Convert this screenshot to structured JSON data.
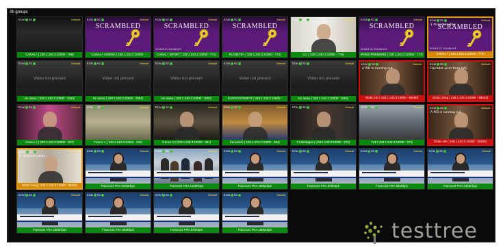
{
  "panel": {
    "title": "All groups"
  },
  "indicator": {
    "ecm": "ECM",
    "sc": "SC",
    "default": "Default"
  },
  "tiles": [
    {
      "label": "CANAL+ ( 228.1.240.2:10000 - 769)",
      "status": "green",
      "video": "dark-text",
      "frame": "none"
    },
    {
      "label": "CANAL+ CINEMA ( 228.1.240.2:10000 -",
      "status": "green",
      "video": "scrambled",
      "frame": "none"
    },
    {
      "label": "CANAL+ SPORT ( 228.1.240.2:10000 - 771)",
      "status": "green",
      "video": "scrambled",
      "frame": "none",
      "foot": "2018-8-21 20h18m21"
    },
    {
      "label": "PLANETE+ ( 228.1.240.2:10000 - 772)",
      "status": "green",
      "video": "scrambled",
      "frame": "none"
    },
    {
      "label": "LCI ( 228.1.240.2:10000 - 776)",
      "status": "green",
      "video": "face-white",
      "frame": "none"
    },
    {
      "label": "PARIS PREMIERE ( 228.1.240.2:10000 - 777)",
      "status": "green",
      "video": "scrambled",
      "frame": "none",
      "foot": "2018-8-21 20h18m23"
    },
    {
      "label": "CANAL+ ( 228.1.240.2:10000 - 778)",
      "status": "orange",
      "video": "scrambled",
      "frame": "orange",
      "error": "1 discontinuities",
      "foot": "2018-8-21 20h18m23"
    },
    {
      "label": "No name ( 228.1.240.2:10000 - 1050)",
      "status": "green",
      "video": "notpresent",
      "frame": "none"
    },
    {
      "label": "No name ( 228.1.240.2:10000 - 1051)",
      "status": "green",
      "video": "notpresent",
      "frame": "none"
    },
    {
      "label": "No name ( 228.1.240.2:10000 - 1052)",
      "status": "green",
      "video": "notpresent",
      "frame": "none"
    },
    {
      "label": "DATASYSTEM R7 ( 228.1.240.2:10000 -",
      "status": "green",
      "video": "notpresent",
      "frame": "none"
    },
    {
      "label": "No name ( 228.1.240.2:10000 - 1054)",
      "status": "green",
      "video": "notpresent",
      "frame": "none"
    },
    {
      "label": "Globo HD ( 228.1.240.3:10000 - 59200)",
      "status": "red",
      "video": "face-woman",
      "frame": "red",
      "error": "A PID is running out"
    },
    {
      "label": "Globo 1Seg ( 228.1.240.3:10000 - 59224)",
      "status": "red",
      "video": "face-woman",
      "frame": "red",
      "error": "Decoder error from AAC"
    },
    {
      "label": "France 2 ( 228.1.240.3:10000 - 257)",
      "status": "green",
      "video": "face-pink",
      "frame": "none"
    },
    {
      "label": "France 4 ( 228.1.240.3:10000 - 260)",
      "status": "green",
      "video": "outdoor",
      "frame": "none"
    },
    {
      "label": "France O ( 228.1.240.3:10000 - 261)",
      "status": "green",
      "video": "dark-scene",
      "frame": "none"
    },
    {
      "label": "francelnfo ( 228.1.240.3:10000 - 262)",
      "status": "green",
      "video": "news-man",
      "frame": "none"
    },
    {
      "label": "F3 Bretagne ( 228.1.240.3:10000 - 274)",
      "status": "green",
      "video": "face-man",
      "frame": "none"
    },
    {
      "label": "TV8 ( 228.1.240.3:10000 - 373)",
      "status": "green",
      "video": "street",
      "frame": "none"
    },
    {
      "label": "Globo HD ( 228.1.240.2:10000 - 59200)",
      "status": "red",
      "video": "face-woman",
      "frame": "red",
      "error": "A PID is running out"
    },
    {
      "label": "Globo 1Seg ( 228.1.240.2:10000 - 59224)",
      "status": "orange",
      "video": "face-suit",
      "frame": "orange",
      "error": "1 discontinuities"
    },
    {
      "label": "France24 FRA 2305Kbps",
      "status": "green",
      "video": "news-anchor",
      "frame": "none"
    },
    {
      "label": "France24 FRA 1425Kbps",
      "status": "green",
      "video": "news-crowd",
      "frame": "none"
    },
    {
      "label": "France24 FRA 1095Kbps",
      "status": "green",
      "video": "news-anchor",
      "frame": "none"
    },
    {
      "label": "France24 FRA 875Kbps",
      "status": "green",
      "video": "news-anchor",
      "frame": "none"
    },
    {
      "label": "France24 FRA 655Kbps",
      "status": "green",
      "video": "news-anchor",
      "frame": "none"
    },
    {
      "label": "France24 FRA 1425Kbps",
      "status": "green",
      "video": "news-anchor",
      "frame": "none"
    },
    {
      "label": "France24 FRA 2305Kbps",
      "status": "green",
      "video": "news-anchor",
      "frame": "none"
    },
    {
      "label": "France24 FRA 655Kbps",
      "status": "green",
      "video": "news-anchor",
      "frame": "none"
    },
    {
      "label": "France24 FRA 875Kbps",
      "status": "green",
      "video": "news-anchor",
      "frame": "none"
    },
    {
      "label": "France24 FRA 1095Kbps",
      "status": "green",
      "video": "news-anchor",
      "frame": "none"
    }
  ],
  "placeholders": {
    "scrambled": "SCRAMBLED",
    "notpresent": "Video not present"
  },
  "logo": {
    "text": "testtree"
  },
  "colors": {
    "ok": "#0c8a10",
    "error": "#cc1010",
    "warning": "#d68b00",
    "scrambled": "#5d1a7a"
  }
}
